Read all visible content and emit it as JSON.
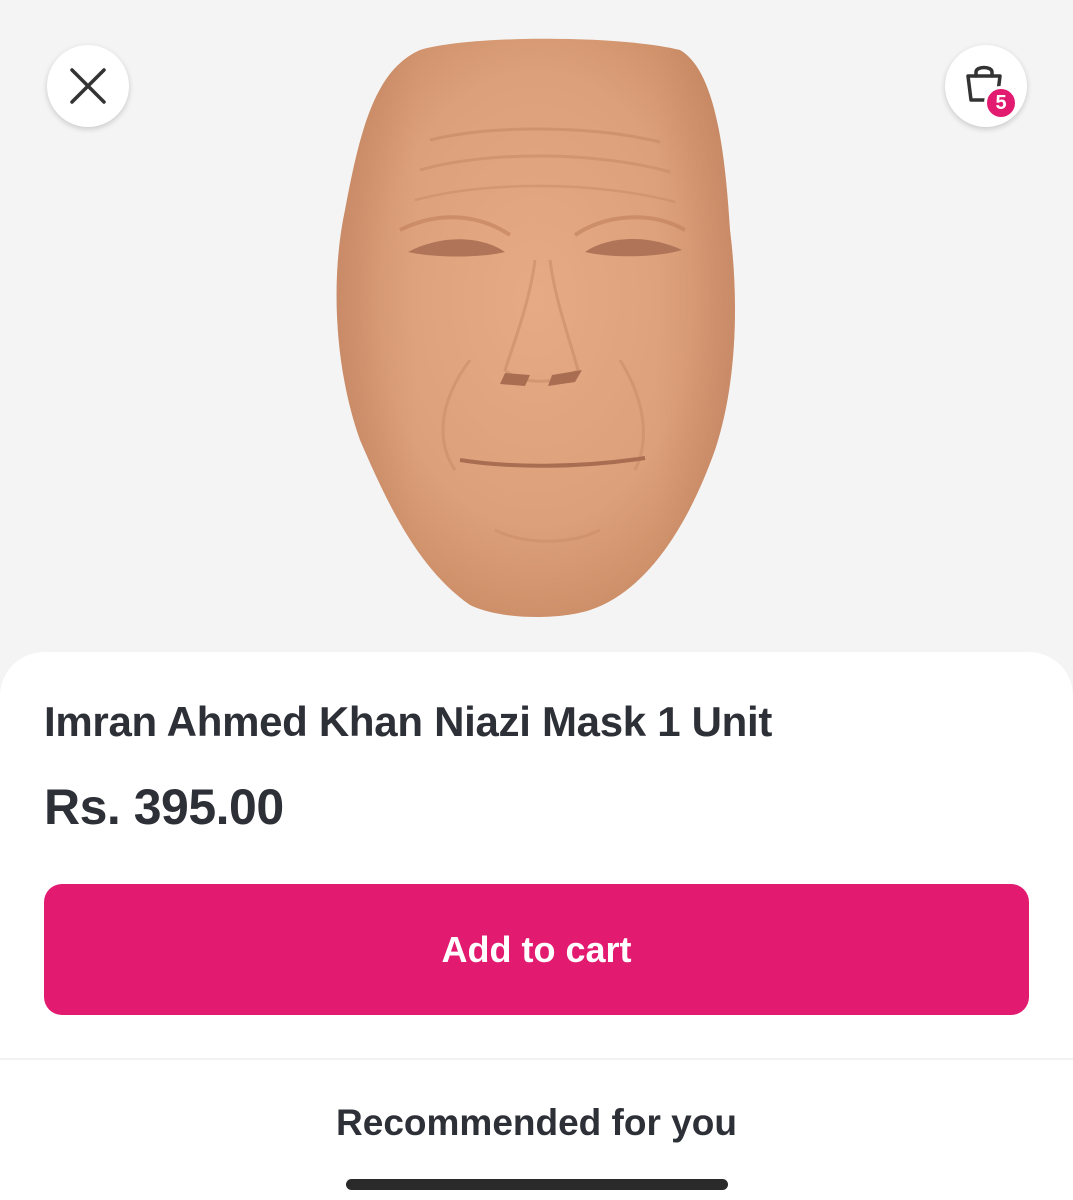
{
  "product": {
    "image_name": "imran-ahmed-khan-niazi-mask",
    "title": "Imran Ahmed Khan Niazi Mask 1 Unit",
    "price": "Rs. 395.00"
  },
  "header": {
    "close_icon": "close-icon",
    "cart_icon": "shopping-bag-icon",
    "cart_count": "5"
  },
  "actions": {
    "add_to_cart_label": "Add to cart"
  },
  "recommendations": {
    "title": "Recommended for you"
  },
  "colors": {
    "accent": "#e21b70",
    "text": "#2e3038",
    "hero_bg": "#f4f4f4"
  }
}
